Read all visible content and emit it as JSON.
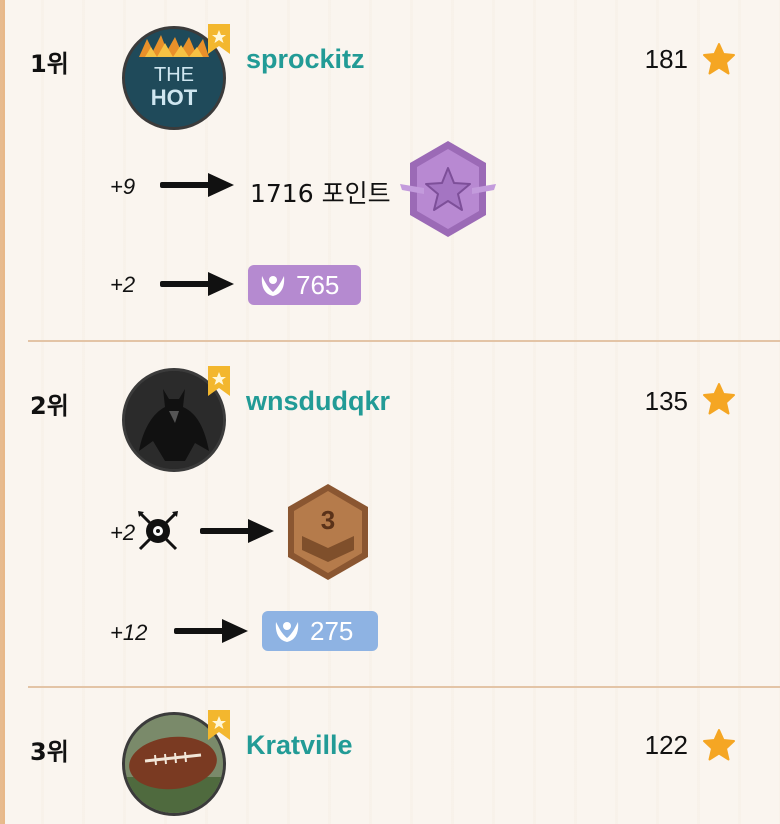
{
  "entries": [
    {
      "rank": "1위",
      "username": "sprockitz",
      "score": "181",
      "avatar_text": [
        "THE",
        "HOT"
      ],
      "rows": [
        {
          "delta": "+9",
          "result": "1716 포인트"
        },
        {
          "delta": "+2",
          "badge_value": "765"
        }
      ]
    },
    {
      "rank": "2위",
      "username": "wnsdudqkr",
      "score": "135",
      "rows": [
        {
          "delta": "+2",
          "result_badge_number": "3"
        },
        {
          "delta": "+12",
          "badge_value": "275"
        }
      ]
    },
    {
      "rank": "3위",
      "username": "Kratville",
      "score": "122"
    }
  ],
  "colors": {
    "username": "#229b96",
    "star": "#f5a623",
    "purple_badge": "#b58ad0",
    "blue_badge": "#8eb3e3",
    "bronze_badge": "#a96f42",
    "divider": "#e3c4a6"
  },
  "icons": {
    "score_star": "star-icon",
    "ribbon": "bookmark-ribbon-icon",
    "arrow": "right-arrow-icon",
    "laurel": "laurel-icon",
    "rank_hex": "purple-star-hexagon-icon",
    "bronze_hex": "bronze-chevron-hexagon-icon",
    "swords": "crossed-swords-icon"
  }
}
